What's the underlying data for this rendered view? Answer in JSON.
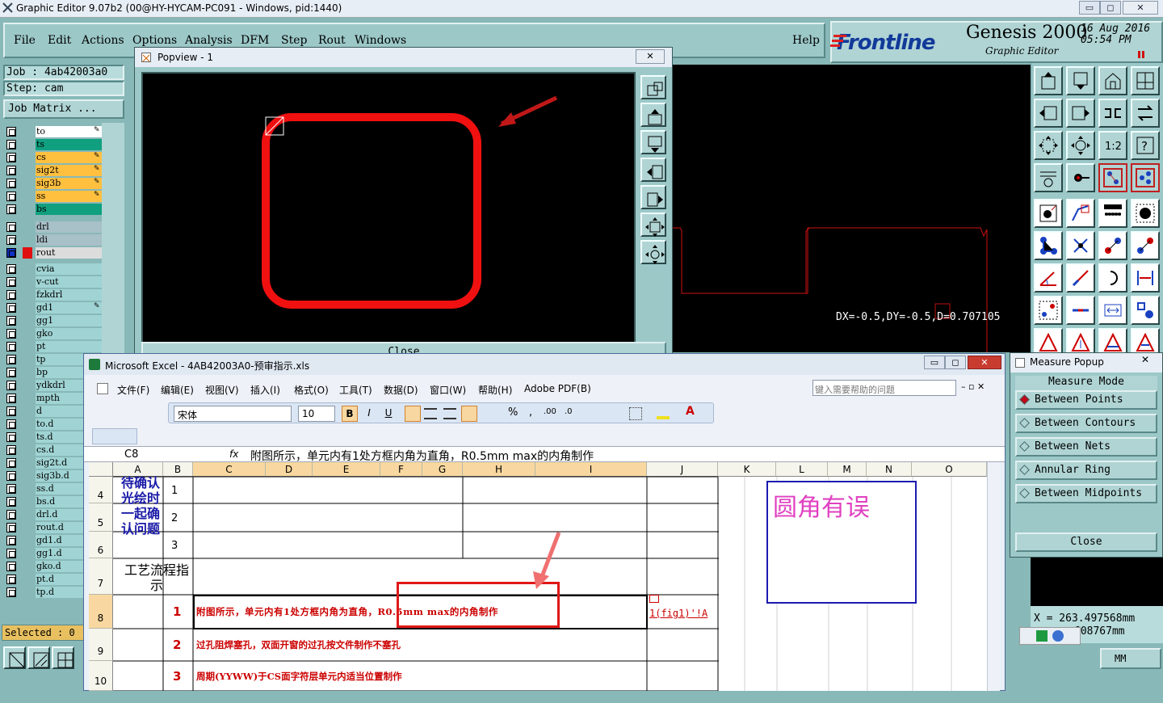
{
  "titlebar": {
    "title": "Graphic Editor 9.07b2 (00@HY-HYCAM-PC091 - Windows, pid:1440)",
    "min": "▭",
    "max": "◻",
    "close": "✕"
  },
  "menu": [
    "File",
    "Edit",
    "Actions",
    "Options",
    "Analysis",
    "DFM",
    "Step",
    "Rout",
    "Windows"
  ],
  "help": "Help",
  "logo": {
    "brand": "Frontline",
    "product": "Genesis 2000",
    "subtitle": "Graphic Editor",
    "date": "16 Aug 2016",
    "time": "05:54 PM"
  },
  "job": {
    "job_label": "Job : 4ab42003a0",
    "step_label": "Step: cam",
    "matrix_button": "Job Matrix ..."
  },
  "layers": [
    {
      "name": "to",
      "color": "#ffffff",
      "edit": true
    },
    {
      "name": "ts",
      "color": "#10a080",
      "edit": false
    },
    {
      "name": "cs",
      "color": "#ffc040",
      "edit": true
    },
    {
      "name": "sig2t",
      "color": "#ffc040",
      "edit": true
    },
    {
      "name": "sig3b",
      "color": "#ffc040",
      "edit": true
    },
    {
      "name": "ss",
      "color": "#ffc040",
      "edit": true
    },
    {
      "name": "bs",
      "color": "#10a080",
      "edit": false
    },
    {
      "name": "drl",
      "color": "#a8c0c8",
      "edit": false
    },
    {
      "name": "ldi",
      "color": "#a8c0c8",
      "edit": false
    },
    {
      "name": "rout",
      "color": "#dcdcdc",
      "edit": false
    },
    {
      "name": "cvia",
      "color": "#a0d4d4",
      "edit": false
    },
    {
      "name": "v-cut",
      "color": "#a0d4d4",
      "edit": false
    },
    {
      "name": "fzkdrl",
      "color": "#a0d4d4",
      "edit": false
    },
    {
      "name": "gd1",
      "color": "#a0d4d4",
      "edit": true
    },
    {
      "name": "gg1",
      "color": "#a0d4d4",
      "edit": false
    },
    {
      "name": "gko",
      "color": "#a0d4d4",
      "edit": false
    },
    {
      "name": "pt",
      "color": "#a0d4d4",
      "edit": false
    },
    {
      "name": "tp",
      "color": "#a0d4d4",
      "edit": false
    },
    {
      "name": "bp",
      "color": "#a0d4d4",
      "edit": false
    },
    {
      "name": "ydkdrl",
      "color": "#a0d4d4",
      "edit": false
    },
    {
      "name": "mpth",
      "color": "#a0d4d4",
      "edit": false
    },
    {
      "name": "d",
      "color": "#a0d4d4",
      "edit": false
    },
    {
      "name": "to.d",
      "color": "#a0d4d4",
      "edit": false
    },
    {
      "name": "ts.d",
      "color": "#a0d4d4",
      "edit": false
    },
    {
      "name": "cs.d",
      "color": "#a0d4d4",
      "edit": false
    },
    {
      "name": "sig2t.d",
      "color": "#a0d4d4",
      "edit": false
    },
    {
      "name": "sig3b.d",
      "color": "#a0d4d4",
      "edit": false
    },
    {
      "name": "ss.d",
      "color": "#a0d4d4",
      "edit": false
    },
    {
      "name": "bs.d",
      "color": "#a0d4d4",
      "edit": false
    },
    {
      "name": "drl.d",
      "color": "#a0d4d4",
      "edit": false
    },
    {
      "name": "rout.d",
      "color": "#a0d4d4",
      "edit": false
    },
    {
      "name": "gd1.d",
      "color": "#a0d4d4",
      "edit": false
    },
    {
      "name": "gg1.d",
      "color": "#a0d4d4",
      "edit": false
    },
    {
      "name": "gko.d",
      "color": "#a0d4d4",
      "edit": false
    },
    {
      "name": "pt.d",
      "color": "#a0d4d4",
      "edit": false
    },
    {
      "name": "tp.d",
      "color": "#a0d4d4",
      "edit": false
    }
  ],
  "selected": "Selected : 0",
  "popview": {
    "title": "Popview - 1",
    "close": "Close"
  },
  "measure_text": "DX=-0.5,DY=-0.5,D=0.707105",
  "coords": {
    "x": "X = 263.497568mm",
    "y": "608767mm"
  },
  "units": "MM",
  "measure_popup": {
    "title": "Measure Popup",
    "mode": "Measure Mode",
    "options": [
      "Between Points",
      "Between Contours",
      "Between Nets",
      "Annular Ring",
      "Between Midpoints"
    ],
    "selected": 0,
    "close": "Close"
  },
  "excel": {
    "title": "Microsoft Excel - 4AB42003A0-预审指示.xls",
    "menu": [
      "文件(F)",
      "编辑(E)",
      "视图(V)",
      "插入(I)",
      "格式(O)",
      "工具(T)",
      "数据(D)",
      "窗口(W)",
      "帮助(H)",
      "Adobe PDF(B)"
    ],
    "help_box": "键入需要帮助的问题",
    "font": "宋体",
    "size": "10",
    "cell_ref": "C8",
    "formula": "附图所示，单元内有1处方框内角为直角，R0.5mm max的内角制作",
    "columns": [
      "A",
      "B",
      "C",
      "D",
      "E",
      "F",
      "G",
      "H",
      "I",
      "J",
      "K",
      "L",
      "M",
      "N",
      "O"
    ],
    "rows": [
      "4",
      "5",
      "6",
      "7",
      "8",
      "9",
      "10"
    ],
    "a_text1": "待确认光绘时一起确认问题",
    "a_text2": "工艺流程指示",
    "b_nums": [
      "1",
      "2",
      "3",
      "1",
      "2",
      "3"
    ],
    "row8_text": "附图所示，单元内有1处方框内角为直角，R0.5mm max的内角制作",
    "row9_text": "过孔阻焊塞孔，双面开窗的过孔按文件制作不塞孔",
    "row10_text": "周期(YYWW)于CS面字符层单元内适当位置制作",
    "link_text": "1(fig1)'!A",
    "note": "圆角有误"
  }
}
